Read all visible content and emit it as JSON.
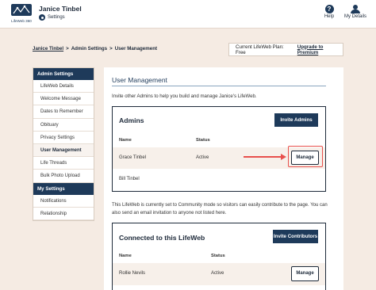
{
  "header": {
    "logo_text": "LifeWeb 360",
    "user_name": "Janice Tinbel",
    "settings_label": "Settings",
    "help_label": "Help",
    "my_details_label": "My Details"
  },
  "breadcrumb": [
    "Janice Tinbel",
    "Admin Settings",
    "User Management"
  ],
  "breadcrumb_sep": ">",
  "plan": {
    "text": "Current LifeWeb Plan: Free",
    "upgrade_label": "Upgrade to Premium"
  },
  "sidebar": {
    "admin_header": "Admin Settings",
    "admin_items": [
      "LifeWeb Details",
      "Welcome Message",
      "Dates to Remember",
      "Obituary",
      "Privacy Settings",
      "User Management",
      "Life Threads",
      "Bulk Photo Upload"
    ],
    "active_item": "User Management",
    "my_header": "My Settings",
    "my_items": [
      "Notifications",
      "Relationship"
    ]
  },
  "main": {
    "title": "User Management",
    "intro": "Invite other Admins to help you build and manage Janice's LifeWeb.",
    "admins": {
      "title": "Admins",
      "invite_label": "Invite Admins",
      "col_name": "Name",
      "col_status": "Status",
      "rows": [
        {
          "name": "Grace Tinbel",
          "status": "Active",
          "action": "Manage"
        },
        {
          "name": "Bill Tinbel",
          "status": "",
          "action": ""
        }
      ]
    },
    "community_text": "This LifeWeb is currently set to Community mode so visitors can easily contribute to the page. You can also send an email invitation to anyone not listed here.",
    "contributors": {
      "title": "Connected to this LifeWeb",
      "invite_label": "Invite Contributors",
      "col_name": "Name",
      "col_status": "Status",
      "rows": [
        {
          "name": "Rollie Nevils",
          "status": "Active",
          "action": "Manage"
        }
      ]
    }
  },
  "colors": {
    "navy": "#1e3a5a",
    "highlight": "#e8504c",
    "background": "#f5ebe3"
  }
}
